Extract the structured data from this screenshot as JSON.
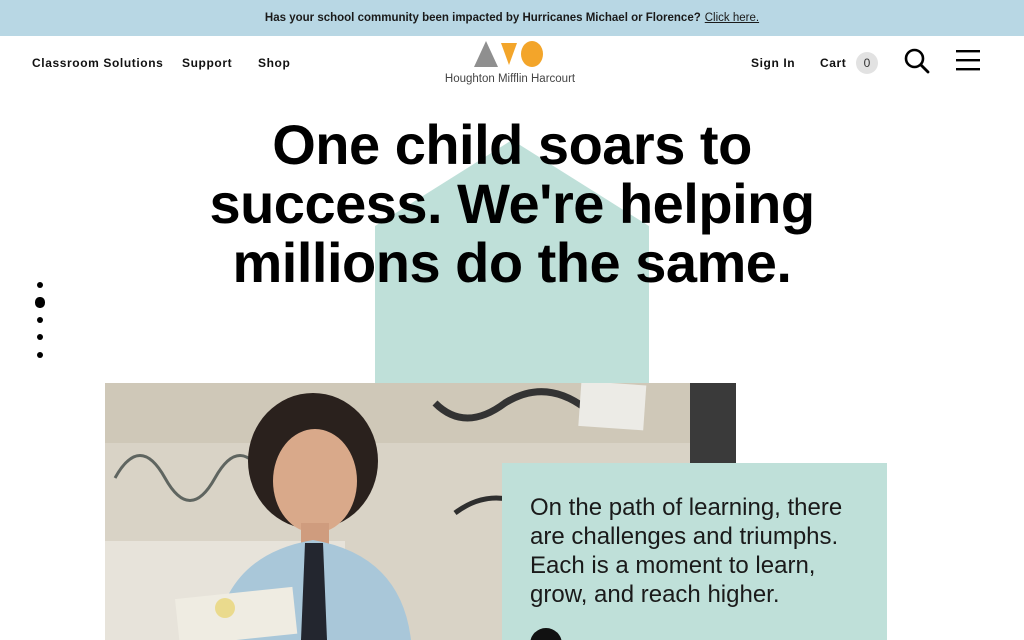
{
  "banner": {
    "text": "Has your school community been impacted by Hurricanes Michael or Florence?",
    "link": "Click here."
  },
  "nav": {
    "left": [
      "Classroom Solutions",
      "Support",
      "Shop"
    ],
    "sign_in": "Sign In",
    "cart_label": "Cart",
    "cart_count": "0",
    "logo_text": "Houghton Mifflin Harcourt",
    "icons": [
      "search-icon",
      "hamburger-menu-icon"
    ]
  },
  "hero": {
    "headline_lines": [
      "One child soars to",
      "success. We're helping",
      "millions do the same."
    ]
  },
  "slider": {
    "count": 5,
    "active_index": 1
  },
  "card": {
    "lines": [
      "On the path of learning, there",
      "are challenges and triumphs.",
      "Each is a moment to learn,",
      "grow, and reach higher."
    ]
  },
  "colors": {
    "banner_bg": "#b8d7e4",
    "mint": "#bfe0d9",
    "logo_gray": "#8f8f8f",
    "logo_orange": "#f3a52a"
  }
}
